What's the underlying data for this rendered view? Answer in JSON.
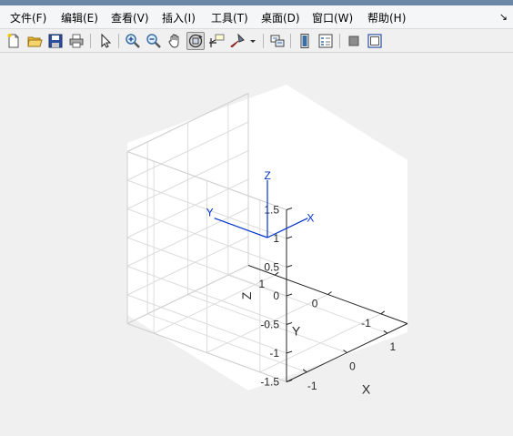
{
  "menubar": {
    "items": [
      "文件(F)",
      "编辑(E)",
      "查看(V)",
      "插入(I)",
      "工具(T)",
      "桌面(D)",
      "窗口(W)",
      "帮助(H)"
    ],
    "dock_glyph": "↘"
  },
  "toolbar": {
    "buttons": [
      {
        "name": "new-figure-icon"
      },
      {
        "name": "open-file-icon"
      },
      {
        "name": "save-figure-icon"
      },
      {
        "name": "print-figure-icon"
      },
      {
        "name": "edit-plot-arrow-icon"
      },
      {
        "name": "zoom-in-icon"
      },
      {
        "name": "zoom-out-icon"
      },
      {
        "name": "pan-hand-icon"
      },
      {
        "name": "rotate-3d-icon",
        "active": true
      },
      {
        "name": "data-cursor-icon"
      },
      {
        "name": "brush-icon"
      },
      {
        "name": "brush-dropdown-chevron-icon"
      },
      {
        "name": "link-plot-icon"
      },
      {
        "name": "insert-colorbar-icon"
      },
      {
        "name": "insert-legend-icon"
      },
      {
        "name": "hide-plot-tools-icon"
      },
      {
        "name": "show-plot-tools-icon"
      }
    ]
  },
  "chart_data": {
    "type": "3d-axes",
    "grid": true,
    "xlabel": "X",
    "ylabel": "Y",
    "zlabel": "Z",
    "xlim": [
      -1.5,
      1.5
    ],
    "ylim": [
      -1.5,
      1.5
    ],
    "zlim": [
      -1.5,
      1.5
    ],
    "xticks": [
      "-1",
      "0",
      "1"
    ],
    "yticks": [
      "-1",
      "0",
      "1"
    ],
    "zticks": [
      "-1.5",
      "-1",
      "-0.5",
      "0",
      "0.5",
      "1",
      "1.5"
    ],
    "series": [
      {
        "label": "X",
        "color": "#0033cc",
        "from": [
          0,
          0,
          0
        ],
        "to": [
          1,
          0,
          0
        ]
      },
      {
        "label": "Y",
        "color": "#0033cc",
        "from": [
          0,
          0,
          0
        ],
        "to": [
          0,
          1,
          0
        ]
      },
      {
        "label": "Z",
        "color": "#0033cc",
        "from": [
          0,
          0,
          0
        ],
        "to": [
          0,
          0,
          1
        ]
      }
    ]
  }
}
